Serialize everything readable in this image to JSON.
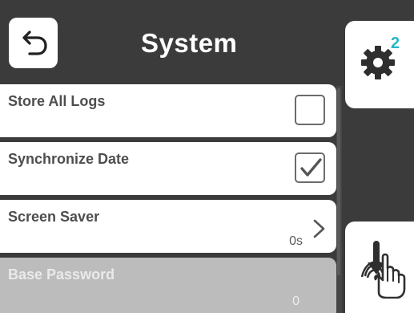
{
  "header": {
    "title": "System",
    "back_icon": "undo-arrow-icon",
    "settings_badge": "2",
    "settings_icon": "gear-icon",
    "action_icon": "touch-hand-icon"
  },
  "settings": {
    "items": [
      {
        "label": "Store All Logs",
        "control": "checkbox",
        "checked": false,
        "enabled": true
      },
      {
        "label": "Synchronize Date",
        "control": "checkbox",
        "checked": true,
        "enabled": true
      },
      {
        "label": "Screen Saver",
        "control": "navigation",
        "value": "0s",
        "chevron": ">",
        "enabled": true
      },
      {
        "label": "Base Password",
        "control": "value",
        "value": "0",
        "enabled": false
      }
    ]
  },
  "colors": {
    "background": "#3b3b3b",
    "card": "#ffffff",
    "disabled_card": "#bcbcbc",
    "text": "#4e4e4e",
    "badge": "#26b7c8"
  }
}
